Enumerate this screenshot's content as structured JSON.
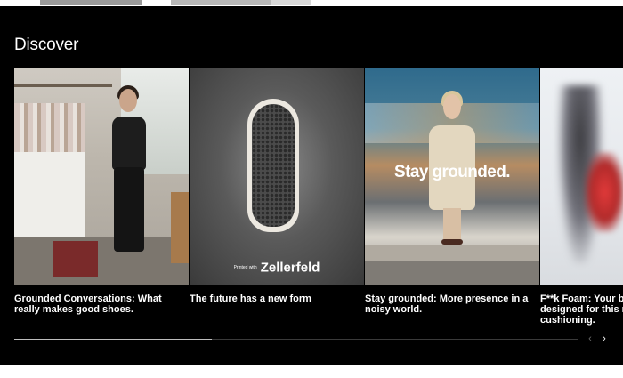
{
  "section": {
    "title": "Discover"
  },
  "cards": [
    {
      "caption": "Grounded Conversations: What really makes good shoes."
    },
    {
      "caption": "The future has a new form",
      "brand_prefix": "Printed with",
      "brand_name": "Zellerfeld"
    },
    {
      "caption": "Stay grounded: More presence in a noisy world.",
      "headline": "Stay grounded."
    },
    {
      "caption_lines": [
        "F**k Foam: Your b",
        "designed for this r",
        "cushioning."
      ]
    }
  ],
  "carousel": {
    "progress": 0.35,
    "prev_icon": "chevron-left-icon",
    "next_icon": "chevron-right-icon"
  },
  "colors": {
    "background": "#000000",
    "text": "#ffffff",
    "progress_fill": "#bdbdbd",
    "progress_track": "#3a3a3a"
  }
}
